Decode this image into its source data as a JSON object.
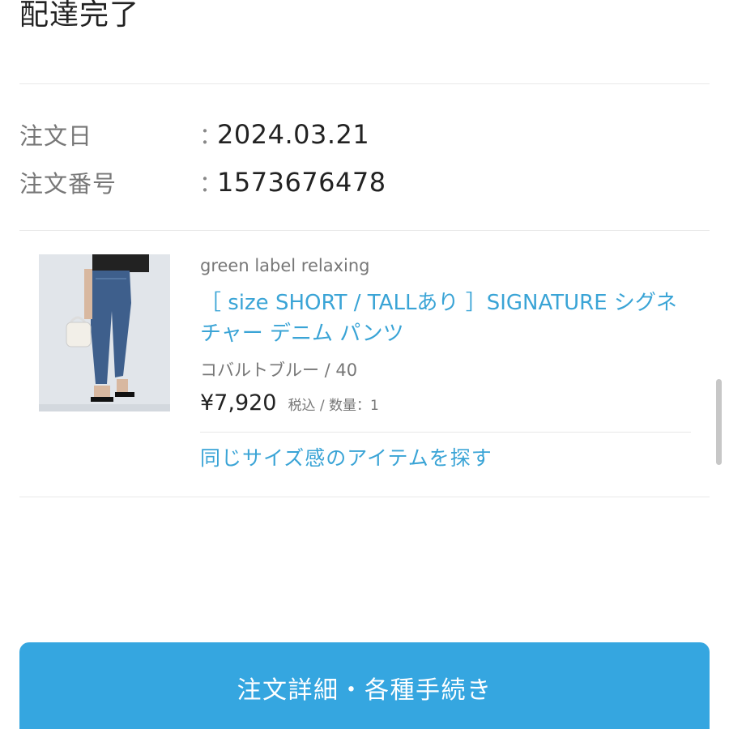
{
  "header": {
    "status_title": "配達完了"
  },
  "order": {
    "date_label": "注文日",
    "date_colon": "：",
    "date_value": "2024.03.21",
    "number_label": "注文番号",
    "number_colon": "：",
    "number_value": "1573676478"
  },
  "item": {
    "image_icon": "product-photo-denim-pants",
    "brand": "green label relaxing",
    "name": "［ size SHORT / TALLあり ］SIGNATURE シグネチャー デニム パンツ",
    "variant": "コバルトブルー / 40",
    "price": "¥7,920",
    "tax_qty": "税込 / 数量：1",
    "similar_link": "同じサイズ感のアイテムを探す"
  },
  "actions": {
    "details_button": "注文詳細・各種手続き"
  },
  "colors": {
    "accent_link": "#3aa4d6",
    "button": "#35a6e0"
  }
}
